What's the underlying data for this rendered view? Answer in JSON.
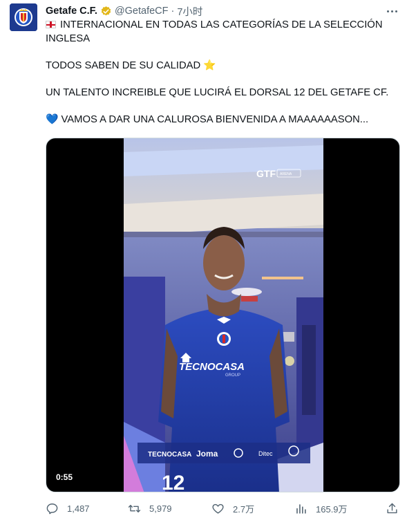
{
  "tweet": {
    "author_name": "Getafe C.F.",
    "handle": "@GetafeCF",
    "separator": "·",
    "time": "7小时",
    "lines": [
      "INTERNACIONAL EN TODAS LAS CATEGORÍAS DE LA SELECCIÓN INGLESA",
      "TODOS SABEN DE SU CALIDAD ⭐",
      "UN TALENTO INCREIBLE QUE LUCIRÁ EL DORSAL 12 DEL GETAFE CF.",
      "💙 VAMOS A DAR UNA CALUROSA BIENVENIDA A MAAAAAASON..."
    ]
  },
  "video": {
    "duration": "0:55",
    "watermark": "GTF",
    "watermark_badge": "ARENA",
    "sponsor_chest": "TECNOCASA",
    "sponsor_chest_sub": "GROUP",
    "sponsor_banner": [
      "TECNOCASA",
      "Joma",
      "Ditec"
    ],
    "shirt_number": "12"
  },
  "actions": {
    "replies": "1,487",
    "retweets": "5,979",
    "likes": "2.7万",
    "views": "165.9万"
  },
  "colors": {
    "text": "#0f1419",
    "muted": "#536471",
    "verified_gold": "#e2b719",
    "club_blue": "#1d3a8f"
  },
  "icons": [
    "verified-badge-icon",
    "more-options-icon",
    "england-flag-icon",
    "reply-icon",
    "retweet-icon",
    "like-icon",
    "views-icon",
    "share-icon"
  ]
}
